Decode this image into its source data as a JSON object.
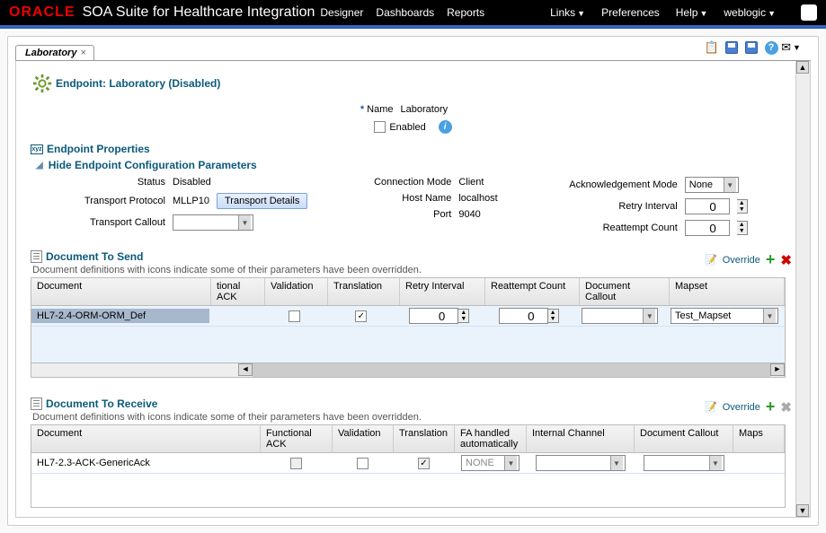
{
  "header": {
    "brand": "ORACLE",
    "app_title": "SOA Suite for Healthcare Integration",
    "nav": {
      "designer": "Designer",
      "dashboards": "Dashboards",
      "reports": "Reports",
      "links": "Links",
      "preferences": "Preferences",
      "help": "Help",
      "user": "weblogic"
    }
  },
  "tab": {
    "label": "Laboratory"
  },
  "endpoint": {
    "title": "Endpoint: Laboratory (Disabled)",
    "name_label": "Name",
    "name_value": "Laboratory",
    "enabled_label": "Enabled"
  },
  "props": {
    "section_title": "Endpoint Properties",
    "hide_link": "Hide Endpoint Configuration Parameters",
    "status_label": "Status",
    "status_value": "Disabled",
    "tproto_label": "Transport Protocol",
    "tproto_value": "MLLP10",
    "tdetails_btn": "Transport Details",
    "tcallout_label": "Transport Callout",
    "conn_label": "Connection Mode",
    "conn_value": "Client",
    "host_label": "Host Name",
    "host_value": "localhost",
    "port_label": "Port",
    "port_value": "9040",
    "ack_label": "Acknowledgement Mode",
    "ack_value": "None",
    "retry_label": "Retry Interval",
    "retry_value": "0",
    "reatt_label": "Reattempt Count",
    "reatt_value": "0"
  },
  "send": {
    "title": "Document To Send",
    "hint": "Document definitions with icons indicate some of their parameters have been overridden.",
    "override": "Override",
    "cols": {
      "doc": "Document",
      "fack": "tional ACK",
      "val": "Validation",
      "trans": "Translation",
      "retry": "Retry Interval",
      "reatt": "Reattempt Count",
      "callout": "Document Callout",
      "mapset": "Mapset"
    },
    "row": {
      "doc": "HL7-2.4-ORM-ORM_Def",
      "retry": "0",
      "reatt": "0",
      "mapset": "Test_Mapset"
    }
  },
  "recv": {
    "title": "Document To Receive",
    "hint": "Document definitions with icons indicate some of their parameters have been overridden.",
    "override": "Override",
    "cols": {
      "doc": "Document",
      "fack": "Functional ACK",
      "val": "Validation",
      "trans": "Translation",
      "fahandle": "FA handled automatically",
      "chan": "Internal Channel",
      "callout": "Document Callout",
      "mapset": "Maps"
    },
    "row": {
      "doc": "HL7-2.3-ACK-GenericAck",
      "fahandle": "NONE"
    }
  }
}
